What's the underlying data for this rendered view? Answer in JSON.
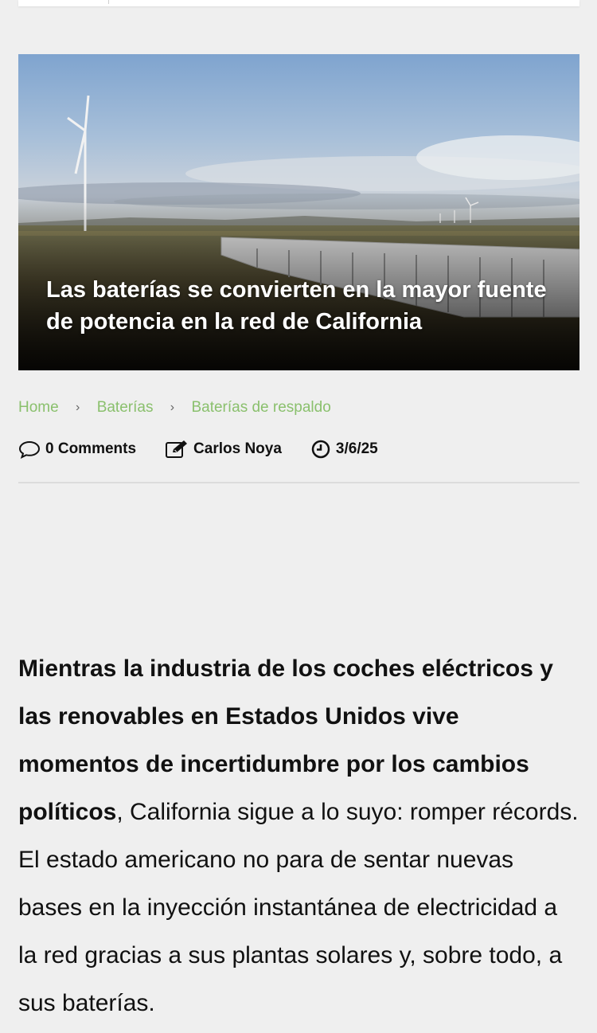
{
  "hero": {
    "title": "Las baterías se convierten en la mayor fuente de potencia en la red de California"
  },
  "breadcrumb": {
    "items": [
      "Home",
      "Baterías",
      "Baterías de respaldo"
    ],
    "separator": "›"
  },
  "meta": {
    "comments": "0 Comments",
    "author": "Carlos Noya",
    "date": "3/6/25"
  },
  "article": {
    "lead_bold": "Mientras la industria de los coches eléctricos y las renovables en Estados Unidos vive momentos de incertidumbre por los cambios políticos",
    "lead_rest": ", California sigue a lo suyo: romper récords. El estado americano no para de sentar nuevas bases en la inyección instantánea de electricidad a la red gracias a sus plantas solares y, sobre todo, a sus baterías."
  },
  "colors": {
    "background": "#efefef",
    "breadcrumb_link": "#8ac06d",
    "text": "#111111"
  },
  "icons": [
    "comment-icon",
    "edit-icon",
    "clock-icon",
    "chevron-right-icon"
  ]
}
